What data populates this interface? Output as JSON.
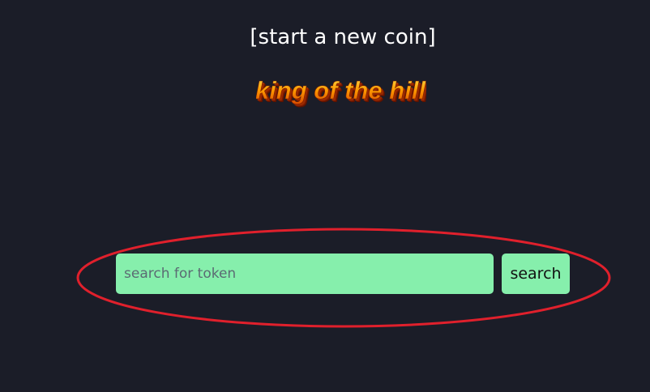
{
  "header": {
    "start_link_label": "[start a new coin]"
  },
  "logo": {
    "text": "king of the hill",
    "colors": {
      "top": "#ffe14a",
      "mid": "#ff9a00",
      "bottom": "#d84a00",
      "shadow": "#6b1500"
    }
  },
  "search": {
    "placeholder": "search for token",
    "value": "",
    "button_label": "search"
  },
  "annotation": {
    "color": "#e0202c"
  },
  "colors": {
    "background": "#1b1d28",
    "accent": "#86efac"
  }
}
